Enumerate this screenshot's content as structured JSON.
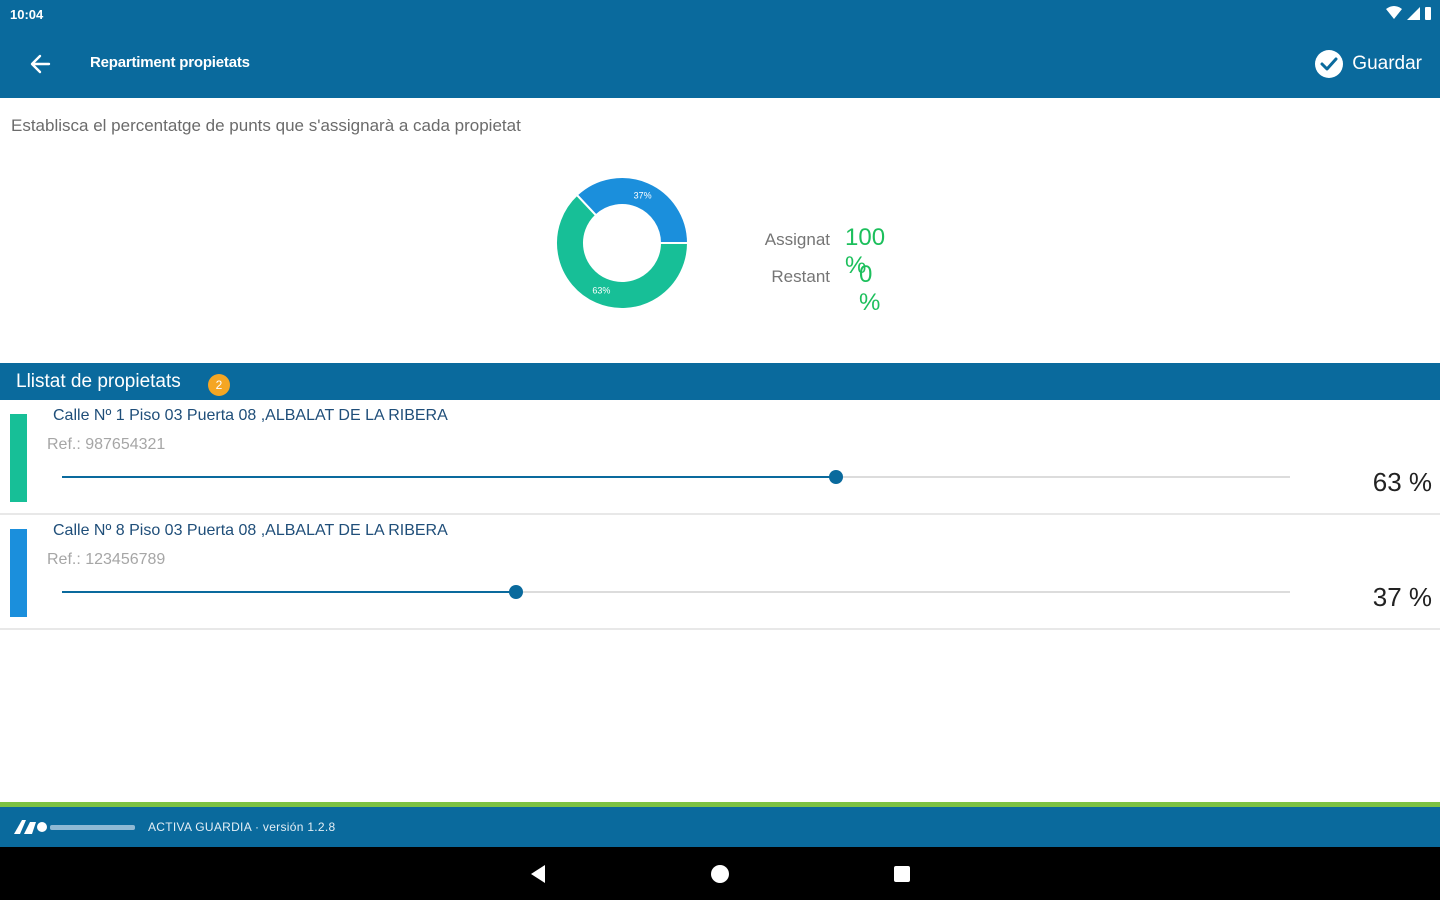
{
  "status_bar": {
    "time": "10:04",
    "icons": [
      "wifi-icon",
      "signal-icon",
      "battery-icon"
    ]
  },
  "app_bar": {
    "back_icon": "arrow-left-icon",
    "title": "Repartiment propietats",
    "save_icon": "check-circle-icon",
    "save_label": "Guardar"
  },
  "subtitle": "Establisca el percentatge de punts que s'assignarà a cada propietat",
  "chart_data": {
    "type": "pie",
    "donut": true,
    "slices": [
      {
        "label": "37%",
        "value": 37,
        "color": "#1b8fdc"
      },
      {
        "label": "63%",
        "value": 63,
        "color": "#17bf97"
      }
    ]
  },
  "summary": {
    "assigned_label": "Assignat",
    "assigned_value": "100 %",
    "remaining_label": "Restant",
    "remaining_value": "0 %"
  },
  "list": {
    "title": "Llistat de propietats",
    "count": "2",
    "items": [
      {
        "address": "Calle Nº 1 Piso 03 Puerta 08 ,ALBALAT DE LA RIBERA",
        "ref": "Ref.: 987654321",
        "percent": 63,
        "percent_label": "63 %",
        "color": "#17bf97"
      },
      {
        "address": "Calle Nº 8 Piso 03 Puerta 08 ,ALBALAT DE LA RIBERA",
        "ref": "Ref.: 123456789",
        "percent": 37,
        "percent_label": "37 %",
        "color": "#1b8fdc"
      }
    ]
  },
  "footer": {
    "text": "ACTIVA GUARDIA · versión 1.2.8"
  },
  "nav_bar": {
    "icons": [
      "back-triangle-icon",
      "home-circle-icon",
      "recents-square-icon"
    ]
  }
}
